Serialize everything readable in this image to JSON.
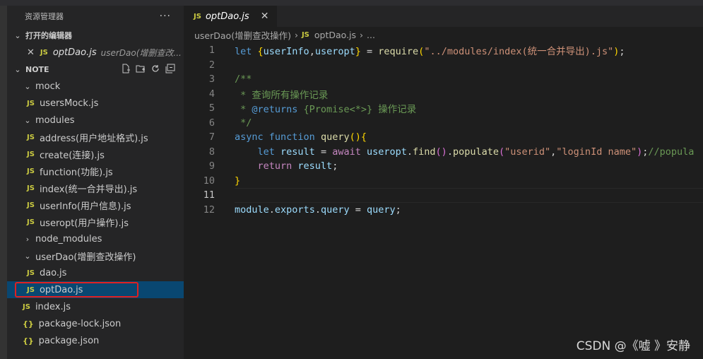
{
  "sidebar": {
    "title": "资源管理器",
    "more": "···",
    "open_editors": {
      "label": "打开的编辑器",
      "items": [
        {
          "close": "✕",
          "icon": "JS",
          "name": "optDao.js",
          "desc": "userDao(增删查改..."
        }
      ]
    },
    "project": {
      "label": "NOTE",
      "tree": [
        {
          "type": "folder",
          "name": "mock",
          "chev": "⌄",
          "depth": 1
        },
        {
          "type": "file",
          "icon": "JS",
          "name": "usersMock.js",
          "depth": 2
        },
        {
          "type": "folder",
          "name": "modules",
          "chev": "⌄",
          "depth": 1
        },
        {
          "type": "file",
          "icon": "JS",
          "name": "address(用户地址格式).js",
          "depth": 2
        },
        {
          "type": "file",
          "icon": "JS",
          "name": "create(连接).js",
          "depth": 2
        },
        {
          "type": "file",
          "icon": "JS",
          "name": "function(功能).js",
          "depth": 2
        },
        {
          "type": "file",
          "icon": "JS",
          "name": "index(统一合并导出).js",
          "depth": 2
        },
        {
          "type": "file",
          "icon": "JS",
          "name": "userInfo(用户信息).js",
          "depth": 2
        },
        {
          "type": "file",
          "icon": "JS",
          "name": "useropt(用户操作).js",
          "depth": 2
        },
        {
          "type": "folder",
          "name": "node_modules",
          "chev": "›",
          "depth": 1
        },
        {
          "type": "folder",
          "name": "userDao(增删查改操作)",
          "chev": "⌄",
          "depth": 1
        },
        {
          "type": "file",
          "icon": "JS",
          "name": "dao.js",
          "depth": 2
        },
        {
          "type": "file",
          "icon": "JS",
          "name": "optDao.js",
          "depth": 2,
          "selected": true
        },
        {
          "type": "file",
          "icon": "JS",
          "name": "index.js",
          "depth": 1
        },
        {
          "type": "file",
          "icon": "{}",
          "name": "package-lock.json",
          "depth": 1
        },
        {
          "type": "file",
          "icon": "{}",
          "name": "package.json",
          "depth": 1
        }
      ]
    }
  },
  "editor": {
    "tab": {
      "icon": "JS",
      "label": "optDao.js",
      "close": "✕"
    },
    "breadcrumb": {
      "folder": "userDao(增删查改操作)",
      "file_icon": "JS",
      "file": "optDao.js",
      "tail": "..."
    },
    "current_line": 11,
    "lines": [
      {
        "n": "1",
        "parts": [
          [
            "kw",
            "let "
          ],
          [
            "br1",
            "{"
          ],
          [
            "var",
            "userInfo"
          ],
          [
            "src",
            ","
          ],
          [
            "var",
            "useropt"
          ],
          [
            "br1",
            "}"
          ],
          [
            "src",
            " = "
          ],
          [
            "fn",
            "require"
          ],
          [
            "br1",
            "("
          ],
          [
            "str",
            "\"../modules/index(统一合并导出).js\""
          ],
          [
            "br1",
            ")"
          ],
          [
            "src",
            ";"
          ]
        ]
      },
      {
        "n": "2",
        "parts": []
      },
      {
        "n": "3",
        "parts": [
          [
            "cm",
            "/**"
          ]
        ]
      },
      {
        "n": "4",
        "parts": [
          [
            "cm",
            " * 查询所有操作记录"
          ]
        ]
      },
      {
        "n": "5",
        "parts": [
          [
            "cm",
            " * "
          ],
          [
            "tag",
            "@returns"
          ],
          [
            "cm",
            " {Promise<*>} 操作记录"
          ]
        ]
      },
      {
        "n": "6",
        "parts": [
          [
            "cm",
            " */"
          ]
        ]
      },
      {
        "n": "7",
        "parts": [
          [
            "kw",
            "async "
          ],
          [
            "kw",
            "function "
          ],
          [
            "fn",
            "query"
          ],
          [
            "br1",
            "()"
          ],
          [
            "br1",
            "{"
          ]
        ]
      },
      {
        "n": "8",
        "parts": [
          [
            "src",
            "    "
          ],
          [
            "kw",
            "let "
          ],
          [
            "var",
            "result"
          ],
          [
            "src",
            " = "
          ],
          [
            "kwc",
            "await "
          ],
          [
            "var",
            "useropt"
          ],
          [
            "src",
            "."
          ],
          [
            "fn",
            "find"
          ],
          [
            "br2",
            "()"
          ],
          [
            "src",
            "."
          ],
          [
            "fn",
            "populate"
          ],
          [
            "br2",
            "("
          ],
          [
            "str",
            "\"userid\""
          ],
          [
            "src",
            ","
          ],
          [
            "str",
            "\"loginId name\""
          ],
          [
            "br2",
            ")"
          ],
          [
            "src",
            ";"
          ],
          [
            "cm",
            "//popula"
          ]
        ]
      },
      {
        "n": "9",
        "parts": [
          [
            "src",
            "    "
          ],
          [
            "kwc",
            "return "
          ],
          [
            "var",
            "result"
          ],
          [
            "src",
            ";"
          ]
        ]
      },
      {
        "n": "10",
        "parts": [
          [
            "br1",
            "}"
          ]
        ]
      },
      {
        "n": "11",
        "parts": []
      },
      {
        "n": "12",
        "parts": [
          [
            "var",
            "module"
          ],
          [
            "src",
            "."
          ],
          [
            "var",
            "exports"
          ],
          [
            "src",
            "."
          ],
          [
            "var",
            "query"
          ],
          [
            "src",
            " = "
          ],
          [
            "var",
            "query"
          ],
          [
            "src",
            ";"
          ]
        ]
      }
    ]
  },
  "watermark": "CSDN @《嘘 》安静",
  "colors": {
    "accent_selected": "#094771",
    "highlight_box": "#e02020",
    "js_icon": "#cbcb41"
  }
}
